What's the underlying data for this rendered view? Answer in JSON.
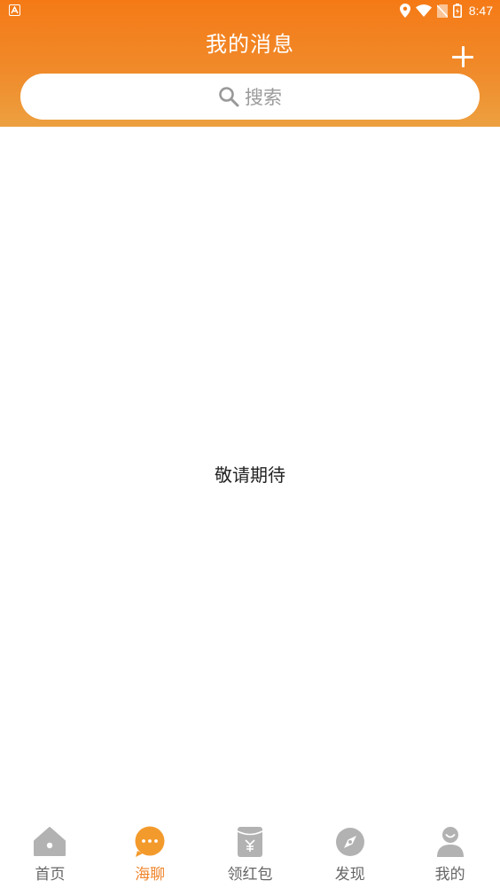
{
  "status_bar": {
    "time": "8:47"
  },
  "header": {
    "title": "我的消息",
    "search_placeholder": "搜索"
  },
  "main": {
    "empty_message": "敬请期待"
  },
  "tabbar": {
    "active_color": "#f0842a",
    "inactive_color": "#b2b2b2",
    "items": [
      {
        "label": "首页",
        "icon": "home-icon",
        "active": false
      },
      {
        "label": "海聊",
        "icon": "chat-bubble-icon",
        "active": true
      },
      {
        "label": "领红包",
        "icon": "red-envelope-icon",
        "active": false
      },
      {
        "label": "发现",
        "icon": "compass-icon",
        "active": false
      },
      {
        "label": "我的",
        "icon": "user-icon",
        "active": false
      }
    ]
  },
  "colors": {
    "header_gradient_top": "#f57a16",
    "header_gradient_bottom": "#eda040"
  }
}
